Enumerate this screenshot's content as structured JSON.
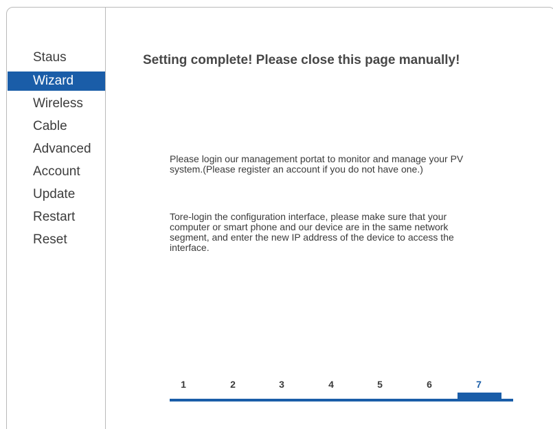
{
  "sidebar": {
    "items": [
      {
        "label": "Staus",
        "active": false
      },
      {
        "label": "Wizard",
        "active": true
      },
      {
        "label": "Wireless",
        "active": false
      },
      {
        "label": "Cable",
        "active": false
      },
      {
        "label": "Advanced",
        "active": false
      },
      {
        "label": "Account",
        "active": false
      },
      {
        "label": "Update",
        "active": false
      },
      {
        "label": "Restart",
        "active": false
      },
      {
        "label": "Reset",
        "active": false
      }
    ]
  },
  "main": {
    "title": "Setting complete! Please close this page manually!",
    "paragraph1": "Please login our management portat to monitor and manage your PV system.(Please register an account if you do not have one.)",
    "paragraph2": "Tore-login the configuration interface, please make sure that your computer or smart phone and our device are in the same network segment, and enter the new IP address of the device to access the interface."
  },
  "steps": {
    "labels": [
      "1",
      "2",
      "3",
      "4",
      "5",
      "6",
      "7"
    ],
    "current": "7"
  },
  "colors": {
    "accent": "#1a5da8",
    "border": "#b9b9b9",
    "text": "#3a3a3a"
  }
}
